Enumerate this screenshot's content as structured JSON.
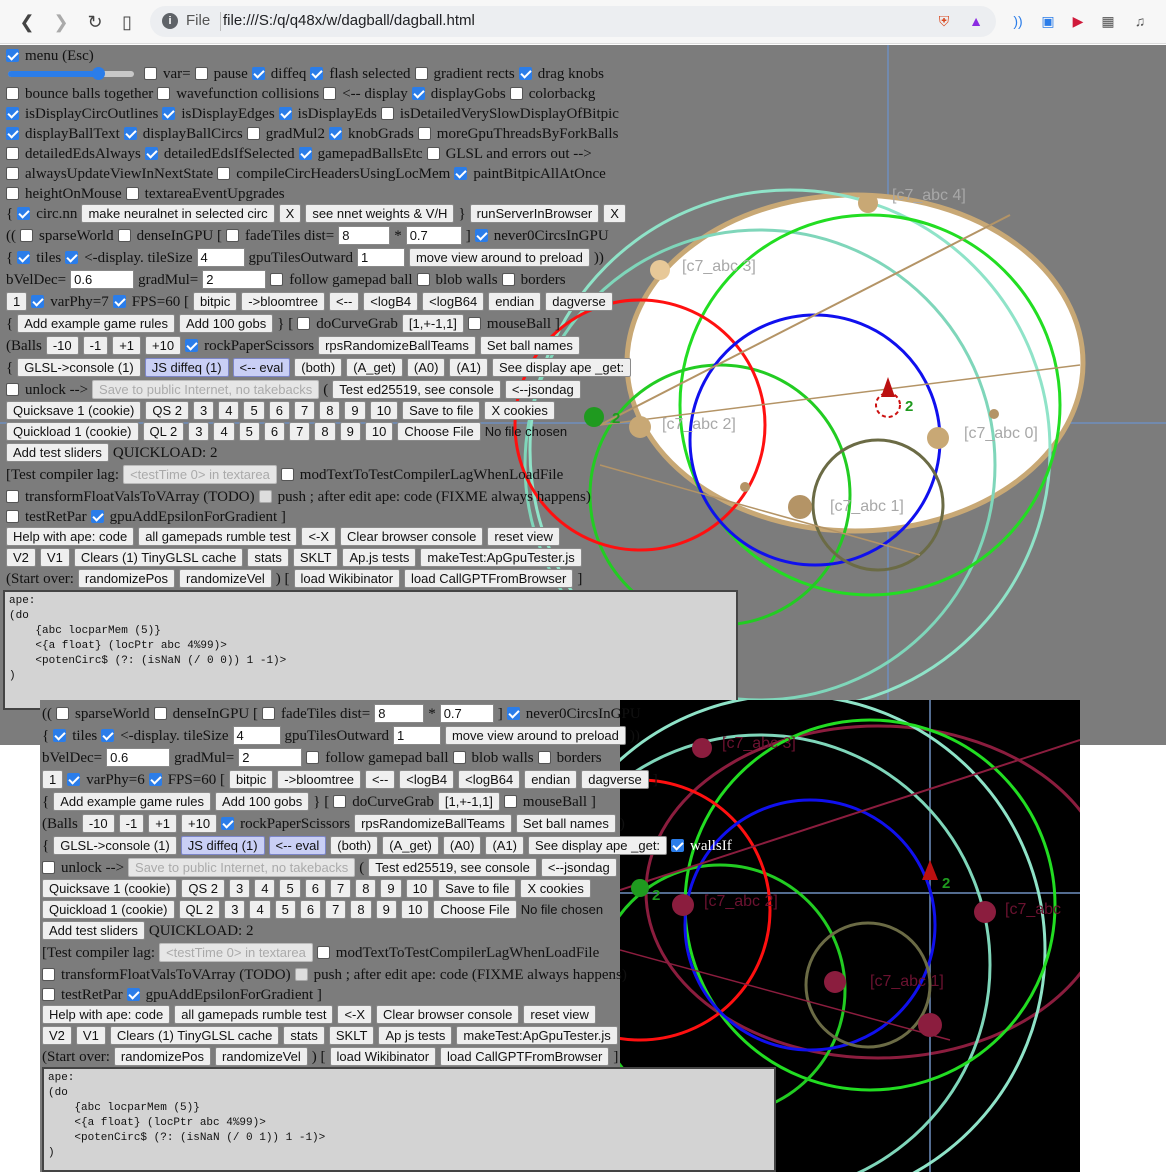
{
  "browser": {
    "file_label": "File",
    "url": "file:///S:/q/q48x/w/dagball/dagball.html"
  },
  "menu": {
    "menu_label": "menu (Esc)",
    "r1": [
      "var=",
      "pause",
      "diffeq",
      "flash selected",
      "gradient rects",
      "drag knobs"
    ],
    "r2": [
      "bounce balls together",
      "wavefunction collisions",
      "<-- display",
      "displayGobs",
      "colorbackg"
    ],
    "r3": [
      "isDisplayCircOutlines",
      "isDisplayEdges",
      "isDisplayEds",
      "isDetailedVerySlowDisplayOfBitpic"
    ],
    "r4": [
      "displayBallText",
      "displayBallCircs",
      "gradMul2",
      "knobGrads",
      "moreGpuThreadsByForkBalls"
    ],
    "r5": [
      "detailedEdsAlways",
      "detailedEdsIfSelected",
      "gamepadBallsEtc",
      "GLSL and errors out -->"
    ],
    "r6": [
      "alwaysUpdateViewInNextState",
      "compileCircHeadersUsingLocMem",
      "paintBitpicAllAtOnce"
    ],
    "r7": [
      "heightOnMouse",
      "textareaEventUpgrades"
    ],
    "r8": {
      "open": "{",
      "circ": "circ.nn",
      "make_nn": "make neuralnet in selected circ",
      "x1": "X",
      "see_nnet": "see nnet weights & V/H",
      "close": "}",
      "run_server": "runServerInBrowser",
      "x2": "X"
    }
  },
  "panel1": {
    "sparse": "sparseWorld",
    "dense": "denseInGPU [",
    "fade": "fadeTiles dist=",
    "fade_val": "8",
    "mult": "*",
    "mult_val": "0.7",
    "never0": "never0CircsInGPU",
    "open2": "((",
    "close_bracket": "]",
    "tiles": "tiles",
    "display_tile": "<-display. tileSize",
    "tile_val": "4",
    "gpu_tiles": "gpuTilesOutward",
    "gpu_val": "1",
    "move_view": "move view around to preload",
    "paren_close": "))",
    "bveldec": "bVelDec=",
    "bveldec_val": "0.6",
    "gradmul": "gradMul=",
    "gradmul_val": "2",
    "follow": "follow gamepad ball",
    "blob": "blob walls",
    "borders": "borders",
    "one": "1",
    "varphy": "varPhy=7",
    "fps": "FPS=60 [",
    "bitpic": "bitpic",
    "bloomtree": "->bloomtree",
    "arrow": "<--",
    "logb4": "<logB4",
    "logb64": "<logB64",
    "endian": "endian",
    "dagverse": "dagverse",
    "bracket_close": "]",
    "add_rules": "Add example game rules",
    "add_gobs": "Add 100 gobs",
    "brace_bracket": "} [",
    "docurve": "doCurveGrab",
    "vec": "[1,+-1,1]",
    "mouseball": "mouseBall ]",
    "balls": "(Balls",
    "m10": "-10",
    "m1": "-1",
    "p1": "+1",
    "p10": "+10",
    "rps": "rockPaperScissors",
    "rps_rand": "rpsRandomizeBallTeams",
    "set_names": "Set ball names",
    "paren": ")",
    "glsl": "GLSL->console (1)",
    "jsdiffeq": "JS diffeq (1)",
    "eval": "<-- eval",
    "both": "(both)",
    "aget": "(A_get)",
    "a0": "(A0)",
    "a1": "(A1)",
    "see_display": "See display ape _get:",
    "wallsif": "wallsIf",
    "unlock": "unlock -->",
    "save_public": "Save to public Internet, no takebacks",
    "lparen": "(",
    "test_ed": "Test ed25519, see console",
    "jsondag": "<--jsondag",
    "quicksave": "Quicksave 1 (cookie)",
    "qs2": "QS 2",
    "nums": [
      "3",
      "4",
      "5",
      "6",
      "7",
      "8",
      "9",
      "10"
    ],
    "save_file": "Save to file",
    "x_cookies": "X cookies",
    "quickload": "Quickload 1 (cookie)",
    "ql2": "QL 2",
    "choose_file": "Choose File",
    "no_file": "No file chosen",
    "add_sliders": "Add test sliders",
    "quickload_status": "QUICKLOAD: 2",
    "test_lag": "[Test compiler lag:",
    "test_time": "<testTime 0> in textarea",
    "mod_text": "modTextToTestCompilerLagWhenLoadFile",
    "transform": "transformFloatValsToVArray (TODO)",
    "push": "push ; after edit ape: code (FIXME always happens)",
    "testretpar": "testRetPar",
    "gpuadd": "gpuAddEpsilonForGradient ]",
    "help": "Help with ape: code",
    "rumble": "all gamepads rumble test",
    "lx": "<-X",
    "clear_console": "Clear browser console",
    "reset_view": "reset view",
    "v2": "V2",
    "v1": "V1",
    "clears": "Clears (1) TinyGLSL cache",
    "stats": "stats",
    "sklt": "SKLT",
    "apjs": "Ap.js tests",
    "maketest": "makeTest:ApGpuTester.js",
    "start_over": "(Start over:",
    "rand_pos": "randomizePos",
    "rand_vel": "randomizeVel",
    "paren_bracket": ")   [",
    "load_wiki": "load Wikibinator",
    "load_gpt": "load CallGPTFromBrowser",
    "end_bracket": "]"
  },
  "panel2": {
    "varphy": "varPhy=6",
    "apjs": "Ap js tests",
    "vec": "[1,+-1,1]"
  },
  "code1": "ape:\n(do\n    {abc locparMem (5)}\n    <{a float} (locPtr abc 4%99)>\n    <potenCirc$ (?: (isNaN (/ 0 0)) 1 -1)>\n)",
  "code2": "ape:\n(do\n    {abc locparMem (5)}\n    <{a float} (locPtr abc 4%99)>\n    <potenCirc$ (?: (isNaN (/ 0 1)) 1 -1)>\n)",
  "scene_labels": {
    "c0": "[c7_abc 0]",
    "c1": "[c7_abc 1]",
    "c2": "[c7_abc 2]",
    "c3": "[c7_abc 3]",
    "c4": "[c7_abc 4]",
    "two": "2",
    "s2_c1": "[c7_abc 1]",
    "s2_c2": "[c7_abc 2]",
    "s2_c3": "[c7_abc 3]",
    "s2_c0": "[c7_abc"
  },
  "colors": {
    "accent": "#2b7de9",
    "canvas_bg": "#7c7c7c",
    "disk_fill": "#ffffff",
    "disk_border": "#c8a875"
  }
}
